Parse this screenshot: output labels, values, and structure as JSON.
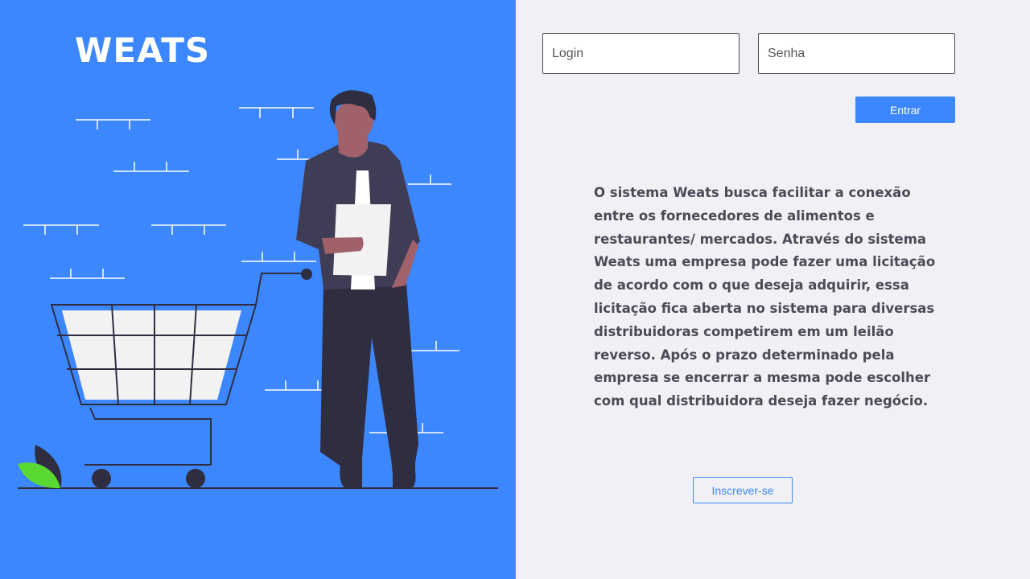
{
  "brand": {
    "title": "WEATS"
  },
  "login_form": {
    "login_placeholder": "Login",
    "password_placeholder": "Senha",
    "submit_label": "Entrar"
  },
  "description": "O sistema Weats busca facilitar a conexão entre os fornecedores de alimentos e restaurantes/ mercados. Através do sistema Weats uma empresa pode fazer uma licitação de acordo com o que deseja adquirir, essa licitação fica aberta no sistema para diversas distribuidoras competirem em um leilão reverso. Após o prazo determinado pela empresa se encerrar a mesma pode escolher com qual distribuidora deseja fazer negócio.",
  "signup": {
    "label": "Inscrever-se"
  },
  "colors": {
    "accent": "#3c87fd",
    "panel_background": "#f1f1f5",
    "text": "#4b4a57",
    "leaf_green": "#5bd933",
    "figure_dark": "#2f2e41"
  },
  "illustration": {
    "icon": "person-with-shopping-cart-illustration"
  }
}
